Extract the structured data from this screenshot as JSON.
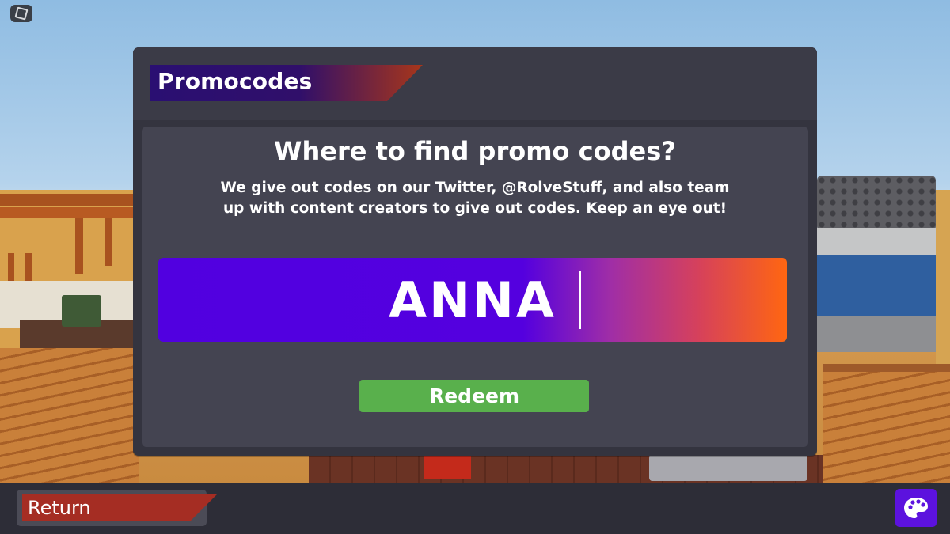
{
  "title": "Promocodes",
  "heading": "Where to find promo codes?",
  "description_line1": "We give out codes on our Twitter, @RolveStuff, and also team",
  "description_line2": "up with content creators to give out codes. Keep an eye out!",
  "code_input": {
    "value": "ANNA"
  },
  "redeem_label": "Redeem",
  "return_label": "Return",
  "icons": {
    "top_left": "roblox-menu-icon",
    "bottom_right": "palette-icon"
  },
  "colors": {
    "title_tag_start": "#2a0f72",
    "title_tag_end": "#a8361a",
    "code_gradient_start": "#5100e0",
    "code_gradient_end": "#ff6611",
    "redeem_green": "#59b04c",
    "return_tag": "#a52d23",
    "palette_button": "#5c12de"
  }
}
